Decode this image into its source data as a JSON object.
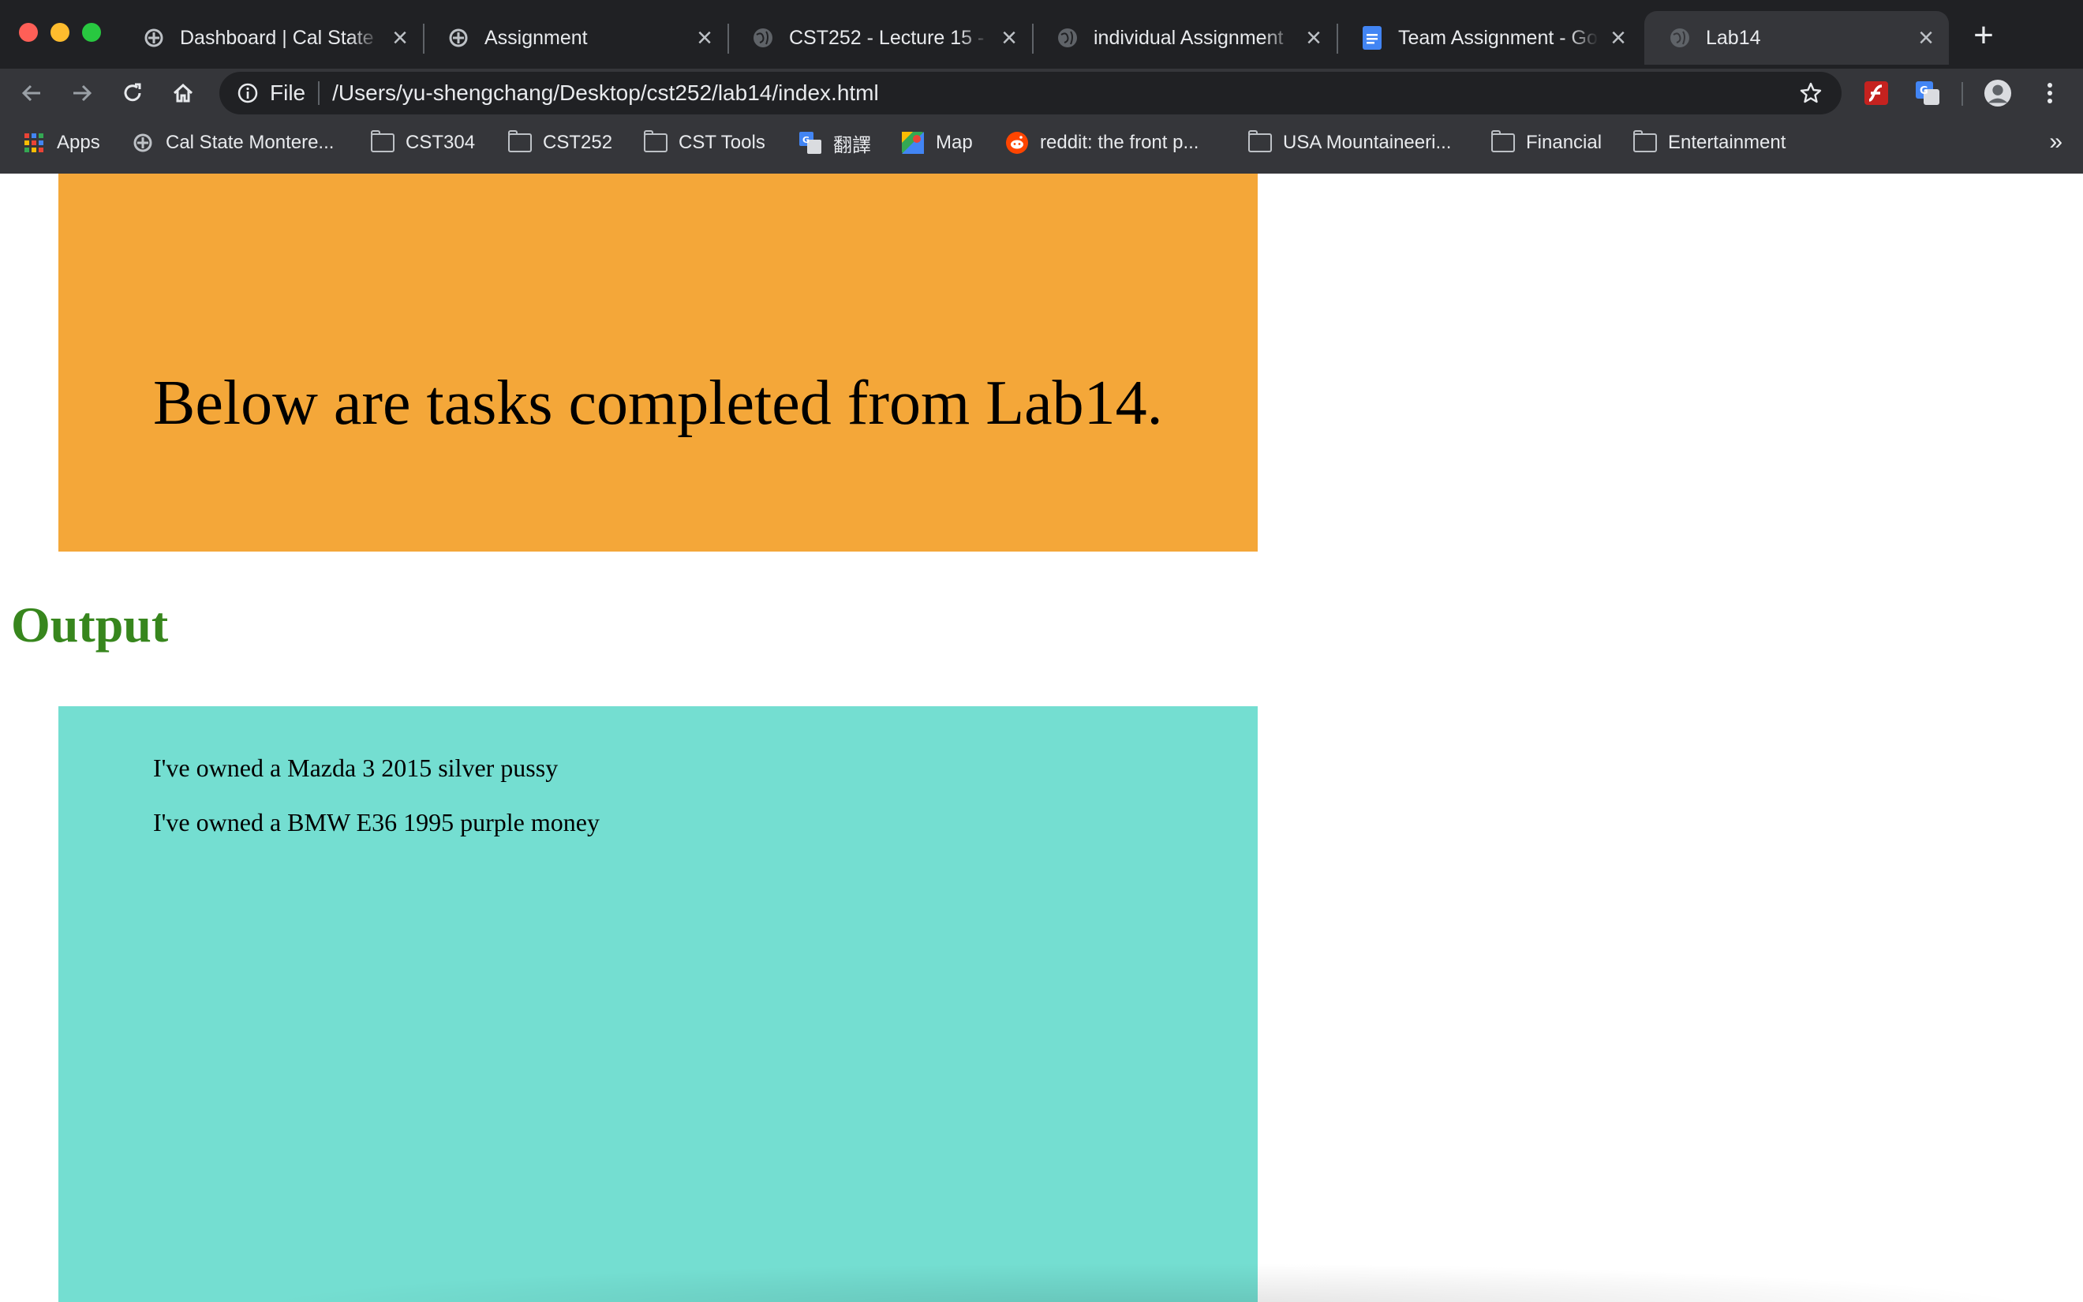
{
  "tabs": [
    {
      "title": "Dashboard | Cal State Monterey Bay",
      "favicon": "csumb-icon"
    },
    {
      "title": "Assignment",
      "favicon": "csumb-icon"
    },
    {
      "title": "CST252 - Lecture 15 - ",
      "favicon": "globe-icon"
    },
    {
      "title": "individual Assignment",
      "favicon": "globe-icon"
    },
    {
      "title": "Team Assignment - Google Docs",
      "favicon": "google-docs-icon"
    },
    {
      "title": "Lab14",
      "favicon": "globe-icon",
      "active": true
    }
  ],
  "omnibox": {
    "scheme": "File",
    "url": "/Users/yu-shengchang/Desktop/cst252/lab14/index.html"
  },
  "bookmarks": [
    {
      "label": "Apps",
      "icon": "apps-grid-icon"
    },
    {
      "label": "Cal State Montere...",
      "icon": "csumb-icon"
    },
    {
      "label": "CST304",
      "icon": "folder-icon"
    },
    {
      "label": "CST252",
      "icon": "folder-icon"
    },
    {
      "label": "CST Tools",
      "icon": "folder-icon"
    },
    {
      "label": "翻譯",
      "icon": "google-translate-icon"
    },
    {
      "label": "Map",
      "icon": "google-maps-icon"
    },
    {
      "label": "reddit: the front p...",
      "icon": "reddit-icon"
    },
    {
      "label": "USA Mountaineeri...",
      "icon": "folder-icon"
    },
    {
      "label": "Financial",
      "icon": "folder-icon"
    },
    {
      "label": "Entertainment",
      "icon": "folder-icon"
    }
  ],
  "page": {
    "intro": "Below are tasks completed from Lab14.",
    "output_heading": "Output",
    "lines": [
      "I've owned a Mazda 3 2015 silver pussy",
      "I've owned a BMW E36 1995 purple money"
    ]
  },
  "colors": {
    "orange_box": "#f4a739",
    "teal_box": "#74ded1",
    "heading_green": "#37861d"
  }
}
